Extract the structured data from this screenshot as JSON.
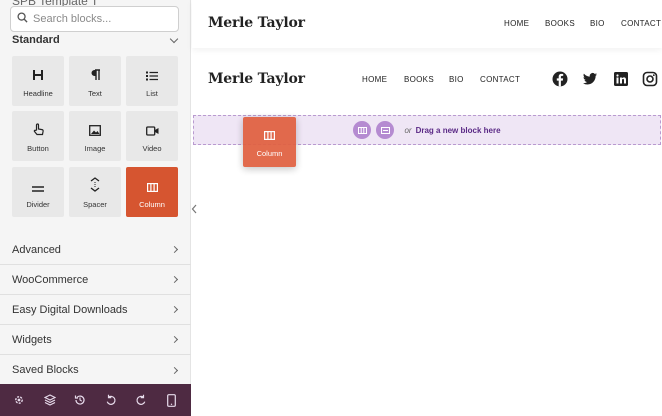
{
  "sidebar": {
    "cut_title": "SPB Template T",
    "search_placeholder": "Search blocks...",
    "section": "Standard",
    "blocks": [
      {
        "label": "Headline",
        "icon": "heading-icon"
      },
      {
        "label": "Text",
        "icon": "paragraph-icon"
      },
      {
        "label": "List",
        "icon": "list-icon"
      },
      {
        "label": "Button",
        "icon": "pointer-hand-icon"
      },
      {
        "label": "Image",
        "icon": "image-icon"
      },
      {
        "label": "Video",
        "icon": "video-camera-icon"
      },
      {
        "label": "Divider",
        "icon": "divider-icon"
      },
      {
        "label": "Spacer",
        "icon": "spacer-icon"
      },
      {
        "label": "Column",
        "icon": "columns-icon",
        "active": true
      }
    ],
    "categories": [
      "Advanced",
      "WooCommerce",
      "Easy Digital Downloads",
      "Widgets",
      "Saved Blocks"
    ],
    "bottom_icons": [
      "settings-icon",
      "layers-icon",
      "history-icon",
      "undo-icon",
      "redo-icon",
      "mobile-preview-icon"
    ]
  },
  "header_preview": {
    "logo": "Merle Taylor",
    "nav": [
      "HOME",
      "BOOKS",
      "BIO",
      "CONTACT"
    ]
  },
  "header_edit": {
    "logo": "Merle Taylor",
    "nav": [
      "HOME",
      "BOOKS",
      "BIO",
      "CONTACT"
    ],
    "social_icons": [
      "facebook-icon",
      "twitter-icon",
      "linkedin-icon",
      "instagram-icon"
    ]
  },
  "dropzone": {
    "or_text": "or",
    "link_text": "Drag a new block here"
  },
  "drag_ghost": {
    "label": "Column"
  },
  "colors": {
    "accent": "#d65530",
    "sidebar_bottom": "#4e2a42",
    "dropzone_bg": "#efe6f5",
    "dropzone_link": "#5b2a86"
  }
}
